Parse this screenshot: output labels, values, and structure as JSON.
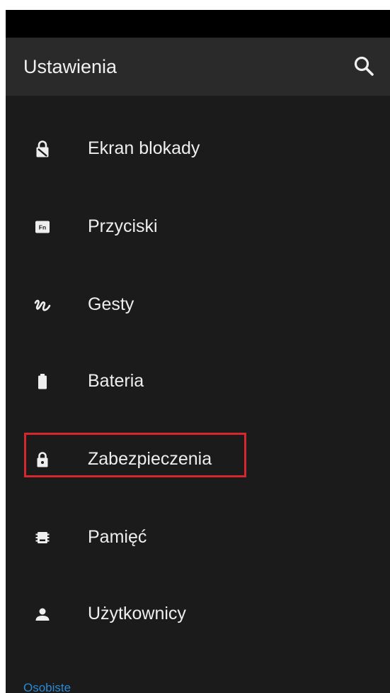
{
  "app_bar": {
    "title": "Ustawienia",
    "search_icon": "search-icon"
  },
  "items": [
    {
      "label": "Ekran blokady",
      "icon": "lock-screen-icon"
    },
    {
      "label": "Przyciski",
      "icon": "fn-key-icon"
    },
    {
      "label": "Gesty",
      "icon": "gesture-icon"
    },
    {
      "label": "Bateria",
      "icon": "battery-icon"
    },
    {
      "label": "Zabezpieczenia",
      "icon": "lock-icon"
    },
    {
      "label": "Pamięć",
      "icon": "storage-chip-icon"
    },
    {
      "label": "Użytkownicy",
      "icon": "person-icon"
    }
  ],
  "section": {
    "label": "Osobiste"
  },
  "colors": {
    "background": "#1b1b1b",
    "app_bar": "#2a2a2a",
    "text": "#eeeeee",
    "accent": "#2a8ad4",
    "highlight": "#d6262e"
  }
}
